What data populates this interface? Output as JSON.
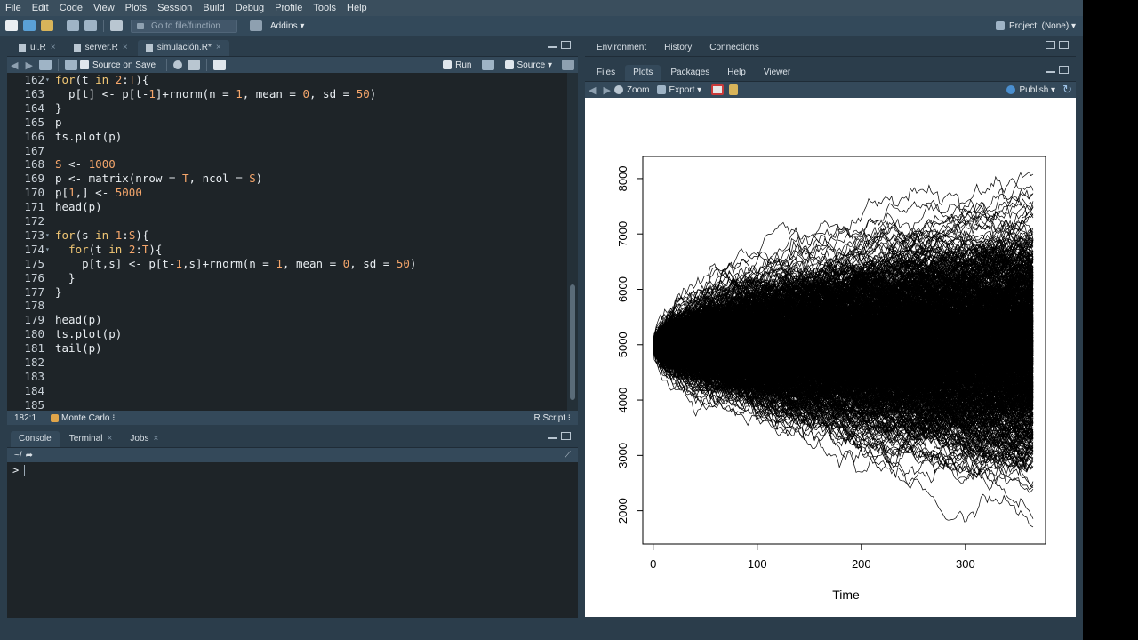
{
  "menubar": [
    "File",
    "Edit",
    "Code",
    "View",
    "Plots",
    "Session",
    "Build",
    "Debug",
    "Profile",
    "Tools",
    "Help"
  ],
  "toolbar": {
    "goto_placeholder": "Go to file/function",
    "addins_label": "Addins",
    "project_label": "Project: (None)"
  },
  "source": {
    "tabs": [
      {
        "label": "ui.R",
        "active": false
      },
      {
        "label": "server.R",
        "active": false
      },
      {
        "label": "simulación.R*",
        "active": true
      }
    ],
    "source_on_save": "Source on Save",
    "run_label": "Run",
    "source_label": "Source",
    "lines": [
      {
        "num": "162",
        "text": "for(t in 2:T){",
        "fold": "▾"
      },
      {
        "num": "163",
        "text": "  p[t] <- p[t-1]+rnorm(n = 1, mean = 0, sd = 50)",
        "fold": ""
      },
      {
        "num": "164",
        "text": "}",
        "fold": ""
      },
      {
        "num": "165",
        "text": "p",
        "fold": ""
      },
      {
        "num": "166",
        "text": "ts.plot(p)",
        "fold": ""
      },
      {
        "num": "167",
        "text": "",
        "fold": ""
      },
      {
        "num": "168",
        "text": "S <- 1000",
        "fold": ""
      },
      {
        "num": "169",
        "text": "p <- matrix(nrow = T, ncol = S)",
        "fold": ""
      },
      {
        "num": "170",
        "text": "p[1,] <- 5000",
        "fold": ""
      },
      {
        "num": "171",
        "text": "head(p)",
        "fold": ""
      },
      {
        "num": "172",
        "text": "",
        "fold": ""
      },
      {
        "num": "173",
        "text": "for(s in 1:S){",
        "fold": "▾"
      },
      {
        "num": "174",
        "text": "  for(t in 2:T){",
        "fold": "▾"
      },
      {
        "num": "175",
        "text": "    p[t,s] <- p[t-1,s]+rnorm(n = 1, mean = 0, sd = 50)",
        "fold": ""
      },
      {
        "num": "176",
        "text": "  }",
        "fold": ""
      },
      {
        "num": "177",
        "text": "}",
        "fold": ""
      },
      {
        "num": "178",
        "text": "",
        "fold": ""
      },
      {
        "num": "179",
        "text": "head(p)",
        "fold": ""
      },
      {
        "num": "180",
        "text": "ts.plot(p)",
        "fold": ""
      },
      {
        "num": "181",
        "text": "tail(p)",
        "fold": ""
      },
      {
        "num": "182",
        "text": "",
        "fold": ""
      },
      {
        "num": "183",
        "text": "",
        "fold": ""
      },
      {
        "num": "184",
        "text": "",
        "fold": ""
      },
      {
        "num": "185",
        "text": "",
        "fold": ""
      }
    ],
    "status": {
      "position": "182:1",
      "section": "Monte Carlo",
      "filetype": "R Script"
    }
  },
  "console": {
    "tabs": [
      {
        "label": "Console",
        "active": true,
        "closable": false
      },
      {
        "label": "Terminal",
        "active": false,
        "closable": true
      },
      {
        "label": "Jobs",
        "active": false,
        "closable": true
      }
    ],
    "path": "~/",
    "prompt": ">"
  },
  "env_pane": {
    "tabs": [
      "Environment",
      "History",
      "Connections"
    ]
  },
  "files_pane": {
    "tabs": [
      {
        "label": "Files",
        "active": false
      },
      {
        "label": "Plots",
        "active": true
      },
      {
        "label": "Packages",
        "active": false
      },
      {
        "label": "Help",
        "active": false
      },
      {
        "label": "Viewer",
        "active": false
      }
    ],
    "zoom_label": "Zoom",
    "export_label": "Export",
    "publish_label": "Publish"
  },
  "chart_data": {
    "type": "line",
    "description_series": "1000 random walk paths, each starting at 5000, 365 time steps, N(0,50) increments",
    "xlabel": "Time",
    "ylabel": "",
    "x_ticks": [
      0,
      100,
      200,
      300
    ],
    "y_ticks": [
      2000,
      3000,
      4000,
      5000,
      6000,
      7000,
      8000
    ],
    "xlim": [
      -10,
      377
    ],
    "ylim": [
      1400,
      8400
    ],
    "n_series": 1000,
    "n_steps": 365,
    "start_value": 5000,
    "step_sd": 50,
    "color": "#000000"
  },
  "colors": {
    "accent": "#2b3d4b",
    "editor_bg": "#1e2428"
  }
}
